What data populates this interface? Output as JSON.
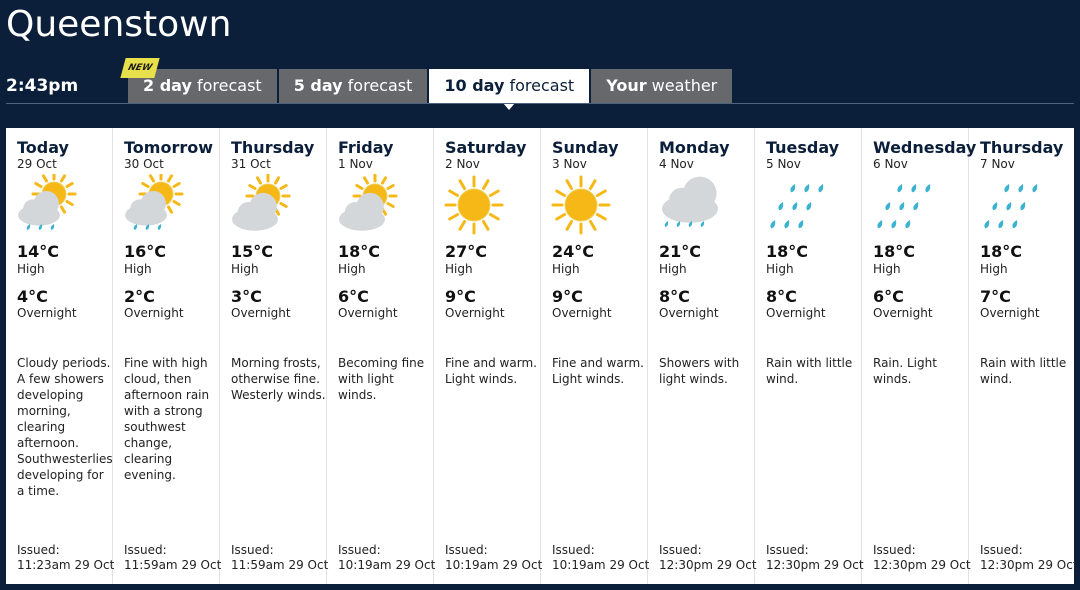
{
  "city": "Queenstown",
  "time": "2:43pm",
  "badge": "NEW",
  "tabs": [
    {
      "bold": "2 day",
      "rest": " forecast"
    },
    {
      "bold": "5 day",
      "rest": " forecast"
    },
    {
      "bold": "10 day",
      "rest": " forecast"
    },
    {
      "bold": "Your",
      "rest": " weather"
    }
  ],
  "issued_label": "Issued:",
  "high_label": "High",
  "overnight_label": "Overnight",
  "days": [
    {
      "name": "Today",
      "date": "29 Oct",
      "icon": "sun-cloud-rain-icon",
      "high": "14°C",
      "low": "4°C",
      "desc": "Cloudy periods. A few showers developing morning, clearing afternoon. Southwesterlies developing for a time.",
      "issued": "11:23am 29 Oct"
    },
    {
      "name": "Tomorrow",
      "date": "30 Oct",
      "icon": "sun-cloud-rain-icon",
      "high": "16°C",
      "low": "2°C",
      "desc": "Fine with high cloud, then afternoon rain with a strong southwest change, clearing evening.",
      "issued": "11:59am 29 Oct"
    },
    {
      "name": "Thursday",
      "date": "31 Oct",
      "icon": "sun-cloud-icon",
      "high": "15°C",
      "low": "3°C",
      "desc": "Morning frosts, otherwise fine. Westerly winds.",
      "issued": "11:59am 29 Oct"
    },
    {
      "name": "Friday",
      "date": "1 Nov",
      "icon": "sun-cloud-icon",
      "high": "18°C",
      "low": "6°C",
      "desc": "Becoming fine with light winds.",
      "issued": "10:19am 29 Oct"
    },
    {
      "name": "Saturday",
      "date": "2 Nov",
      "icon": "sun-icon",
      "high": "27°C",
      "low": "9°C",
      "desc": "Fine and warm. Light winds.",
      "issued": "10:19am 29 Oct"
    },
    {
      "name": "Sunday",
      "date": "3 Nov",
      "icon": "sun-icon",
      "high": "24°C",
      "low": "9°C",
      "desc": "Fine and warm. Light winds.",
      "issued": "10:19am 29 Oct"
    },
    {
      "name": "Monday",
      "date": "4 Nov",
      "icon": "cloud-rain-icon",
      "high": "21°C",
      "low": "8°C",
      "desc": "Showers with light winds.",
      "issued": "12:30pm 29 Oct"
    },
    {
      "name": "Tuesday",
      "date": "5 Nov",
      "icon": "rain-icon",
      "high": "18°C",
      "low": "8°C",
      "desc": "Rain with little wind.",
      "issued": "12:30pm 29 Oct"
    },
    {
      "name": "Wednesday",
      "date": "6 Nov",
      "icon": "rain-icon",
      "high": "18°C",
      "low": "6°C",
      "desc": "Rain. Light winds.",
      "issued": "12:30pm 29 Oct"
    },
    {
      "name": "Thursday",
      "date": "7 Nov",
      "icon": "rain-icon",
      "high": "18°C",
      "low": "7°C",
      "desc": "Rain with little wind.",
      "issued": "12:30pm 29 Oct"
    }
  ],
  "colors": {
    "background": "#0b1f3a",
    "tab": "#66686b",
    "sun": "#f5b817",
    "cloud": "#d4d7da",
    "rain": "#3bb3cf",
    "badge": "#e8e04a"
  }
}
